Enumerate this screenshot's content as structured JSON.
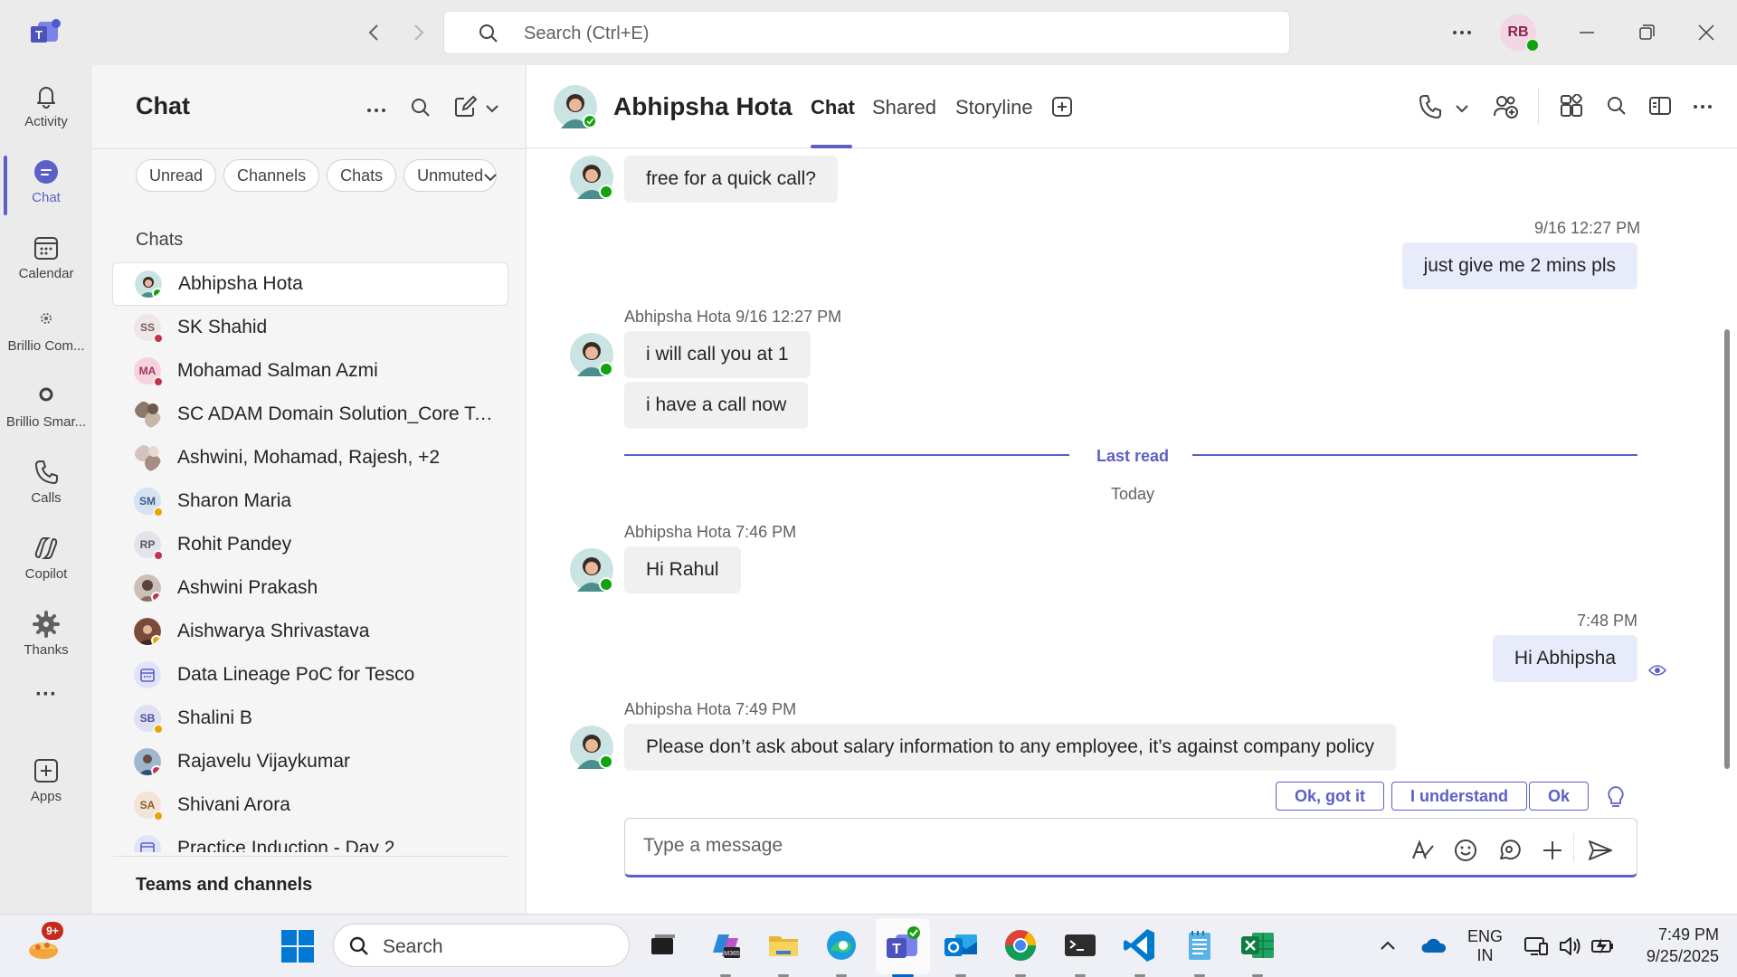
{
  "titlebar": {
    "search_placeholder": "Search (Ctrl+E)",
    "avatar_initials": "RB"
  },
  "rail": {
    "items": [
      {
        "label": "Activity",
        "icon": "bell-icon"
      },
      {
        "label": "Chat",
        "icon": "chat-icon",
        "active": true
      },
      {
        "label": "Calendar",
        "icon": "calendar-icon"
      },
      {
        "label": "Brillio Com...",
        "icon": "app-icon"
      },
      {
        "label": "Brillio Smar...",
        "icon": "app-icon"
      },
      {
        "label": "Calls",
        "icon": "phone-icon"
      },
      {
        "label": "Copilot",
        "icon": "copilot-icon"
      },
      {
        "label": "Thanks",
        "icon": "gear-icon"
      },
      {
        "label": "Apps",
        "icon": "add-app-icon"
      }
    ],
    "more_label": "···"
  },
  "chatlist": {
    "title": "Chat",
    "filters": [
      "Unread",
      "Channels",
      "Chats",
      "Unmuted"
    ],
    "section_label": "Chats",
    "items": [
      {
        "name": "Abhipsha Hota",
        "initials": "",
        "selected": true
      },
      {
        "name": "SK Shahid",
        "initials": "SS"
      },
      {
        "name": "Mohamad Salman Azmi",
        "initials": "MA"
      },
      {
        "name": "SC ADAM Domain Solution_Core Tea...",
        "initials": ""
      },
      {
        "name": "Ashwini, Mohamad, Rajesh, +2",
        "initials": ""
      },
      {
        "name": "Sharon Maria",
        "initials": "SM"
      },
      {
        "name": "Rohit Pandey",
        "initials": "RP"
      },
      {
        "name": "Ashwini Prakash",
        "initials": ""
      },
      {
        "name": "Aishwarya Shrivastava",
        "initials": ""
      },
      {
        "name": "Data Lineage PoC for Tesco",
        "initials": ""
      },
      {
        "name": "Shalini B",
        "initials": "SB"
      },
      {
        "name": "Rajavelu Vijaykumar",
        "initials": ""
      },
      {
        "name": "Shivani Arora",
        "initials": "SA"
      },
      {
        "name": "Practice Induction - Day 2",
        "initials": ""
      }
    ],
    "teams_label": "Teams and channels"
  },
  "conversation": {
    "contact_name": "Abhipsha Hota",
    "tabs": [
      "Chat",
      "Shared",
      "Storyline"
    ],
    "messages": {
      "m1_text": "free for a quick call?",
      "m2_time": "9/16 12:27 PM",
      "m2_text": "just give me 2 mins pls",
      "m3_meta": "Abhipsha Hota  9/16 12:27 PM",
      "m3_text_a": "i will call you at 1",
      "m3_text_b": "i have a call now",
      "last_read": "Last read",
      "today": "Today",
      "m4_meta": "Abhipsha Hota  7:46 PM",
      "m4_text": "Hi Rahul",
      "m5_time": "7:48 PM",
      "m5_text": "Hi Abhipsha",
      "m6_meta": "Abhipsha Hota  7:49 PM",
      "m6_text": "Please don’t ask about salary information to any employee, it’s against company policy"
    },
    "suggestions": [
      "Ok, got it",
      "I understand",
      "Ok"
    ],
    "compose_placeholder": "Type a message"
  },
  "taskbar": {
    "badge": "9+",
    "search_placeholder": "Search",
    "lang_line1": "ENG",
    "lang_line2": "IN",
    "time": "7:49 PM",
    "date": "9/25/2025"
  },
  "colors": {
    "accent": "#5b5fc7",
    "online": "#13a10e",
    "busy": "#c4314b",
    "away": "#eaa300"
  }
}
